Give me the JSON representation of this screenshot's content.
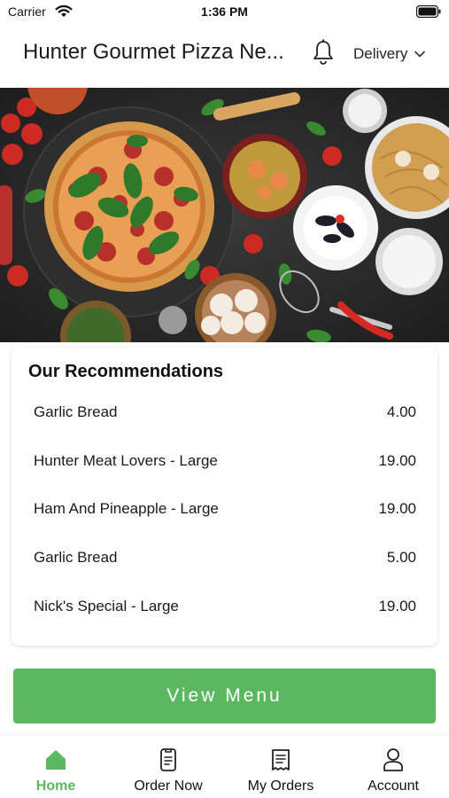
{
  "status_bar": {
    "carrier": "Carrier",
    "time": "1:36 PM"
  },
  "header": {
    "title": "Hunter Gourmet Pizza Ne...",
    "order_type": "Delivery"
  },
  "hero": {
    "icon": "food-banner-image"
  },
  "recommendations": {
    "title": "Our Recommendations",
    "items": [
      {
        "name": "Garlic Bread",
        "price": "4.00"
      },
      {
        "name": "Hunter Meat Lovers - Large",
        "price": "19.00"
      },
      {
        "name": "Ham And Pineapple - Large",
        "price": "19.00"
      },
      {
        "name": "Garlic Bread",
        "price": "5.00"
      },
      {
        "name": "Nick's Special - Large",
        "price": "19.00"
      }
    ]
  },
  "view_menu": {
    "label": "View Menu"
  },
  "bottom_nav": {
    "items": [
      {
        "label": "Home",
        "icon": "home-icon",
        "active": true
      },
      {
        "label": "Order Now",
        "icon": "order-sheet-icon",
        "active": false
      },
      {
        "label": "My Orders",
        "icon": "receipt-icon",
        "active": false
      },
      {
        "label": "Account",
        "icon": "person-icon",
        "active": false
      }
    ]
  },
  "colors": {
    "accent": "#5cb860",
    "text": "#111111"
  }
}
